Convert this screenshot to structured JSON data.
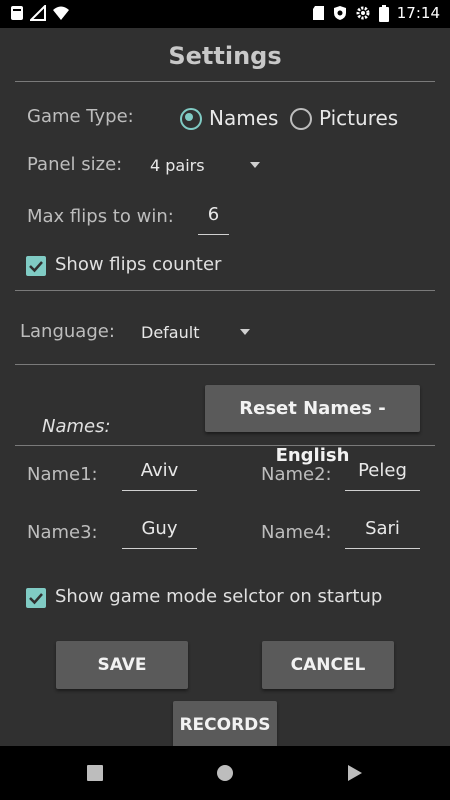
{
  "status_bar": {
    "time": "17:14"
  },
  "settings": {
    "title": "Settings",
    "game_type": {
      "label": "Game Type:",
      "options": [
        "Names",
        "Pictures"
      ],
      "selected": "Names"
    },
    "panel_size": {
      "label": "Panel size:",
      "value": "4 pairs"
    },
    "max_flips": {
      "label": "Max flips to win:",
      "value": "6"
    },
    "show_flips_counter": {
      "label": "Show flips counter",
      "checked": true
    },
    "language": {
      "label": "Language:",
      "value": "Default"
    },
    "names": {
      "section_label": "Names:",
      "reset_button": "Reset Names - English",
      "entries": [
        {
          "label": "Name1:",
          "value": "Aviv"
        },
        {
          "label": "Name2:",
          "value": "Peleg"
        },
        {
          "label": "Name3:",
          "value": "Guy"
        },
        {
          "label": "Name4:",
          "value": "Sari"
        }
      ]
    },
    "show_mode_selector": {
      "label": "Show game mode selctor on startup",
      "checked": true
    },
    "buttons": {
      "save": "SAVE",
      "cancel": "CANCEL",
      "records": "RECORDS"
    },
    "colors": {
      "accent": "#80cbc4",
      "background": "#303030",
      "button": "#5a5a5a"
    }
  }
}
